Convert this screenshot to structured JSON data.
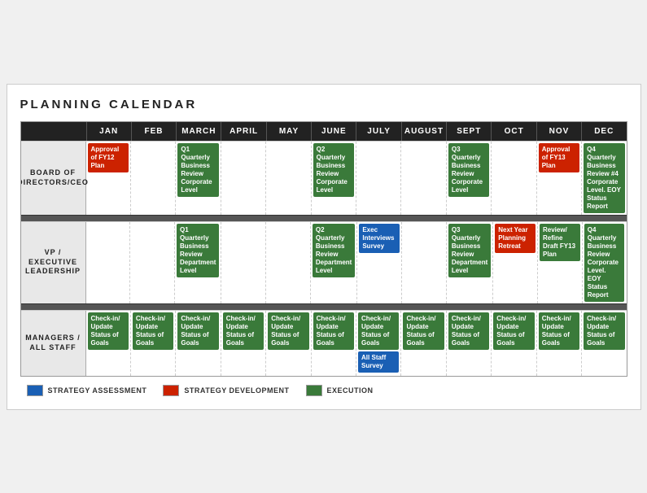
{
  "title": "PLANNING CALENDAR",
  "months": [
    "JAN",
    "FEB",
    "MARCH",
    "APRIL",
    "MAY",
    "JUNE",
    "JULY",
    "AUGUST",
    "SEPT",
    "OCT",
    "NOV",
    "DEC"
  ],
  "sections": [
    {
      "label": "BOARD OF\nDIRECTORS/CEO",
      "cells": [
        {
          "month": 0,
          "events": [
            {
              "color": "red",
              "text": "Approval of FY12 Plan"
            }
          ]
        },
        {
          "month": 1,
          "events": []
        },
        {
          "month": 2,
          "events": [
            {
              "color": "green",
              "text": "Q1 Quarterly Business Review Corporate Level"
            }
          ]
        },
        {
          "month": 3,
          "events": []
        },
        {
          "month": 4,
          "events": []
        },
        {
          "month": 5,
          "events": [
            {
              "color": "green",
              "text": "Q2 Quarterly Business Review Corporate Level"
            }
          ]
        },
        {
          "month": 6,
          "events": []
        },
        {
          "month": 7,
          "events": []
        },
        {
          "month": 8,
          "events": [
            {
              "color": "green",
              "text": "Q3 Quarterly Business Review Corporate Level"
            }
          ]
        },
        {
          "month": 9,
          "events": []
        },
        {
          "month": 10,
          "events": [
            {
              "color": "red",
              "text": "Approval of FY13 Plan"
            }
          ]
        },
        {
          "month": 11,
          "events": [
            {
              "color": "green",
              "text": "Q4 Quarterly Business Review #4 Corporate Level. EOY Status Report"
            }
          ]
        }
      ]
    },
    {
      "label": "VP / EXECUTIVE\nLEADERSHIP",
      "cells": [
        {
          "month": 0,
          "events": []
        },
        {
          "month": 1,
          "events": []
        },
        {
          "month": 2,
          "events": [
            {
              "color": "green",
              "text": "Q1 Quarterly Business Review Department Level"
            }
          ]
        },
        {
          "month": 3,
          "events": []
        },
        {
          "month": 4,
          "events": []
        },
        {
          "month": 5,
          "events": [
            {
              "color": "green",
              "text": "Q2 Quarterly Business Review Department Level"
            }
          ]
        },
        {
          "month": 6,
          "events": [
            {
              "color": "blue",
              "text": "Exec Interviews Survey"
            }
          ]
        },
        {
          "month": 7,
          "events": []
        },
        {
          "month": 8,
          "events": [
            {
              "color": "green",
              "text": "Q3 Quarterly Business Review Department Level"
            }
          ]
        },
        {
          "month": 9,
          "events": [
            {
              "color": "red",
              "text": "Next Year Planning Retreat"
            }
          ]
        },
        {
          "month": 10,
          "events": [
            {
              "color": "green",
              "text": "Review/ Refine Draft FY13 Plan"
            }
          ]
        },
        {
          "month": 11,
          "events": [
            {
              "color": "green",
              "text": "Q4 Quarterly Business Review Corporate Level. EOY Status Report"
            }
          ]
        }
      ]
    },
    {
      "label": "MANAGERS /\nALL STAFF",
      "cells": [
        {
          "month": 0,
          "events": [
            {
              "color": "green",
              "text": "Check-in/ Update Status of Goals"
            }
          ]
        },
        {
          "month": 1,
          "events": [
            {
              "color": "green",
              "text": "Check-in/ Update Status of Goals"
            }
          ]
        },
        {
          "month": 2,
          "events": [
            {
              "color": "green",
              "text": "Check-in/ Update Status of Goals"
            }
          ]
        },
        {
          "month": 3,
          "events": [
            {
              "color": "green",
              "text": "Check-in/ Update Status of Goals"
            }
          ]
        },
        {
          "month": 4,
          "events": [
            {
              "color": "green",
              "text": "Check-in/ Update Status of Goals"
            }
          ]
        },
        {
          "month": 5,
          "events": [
            {
              "color": "green",
              "text": "Check-in/ Update Status of Goals"
            }
          ]
        },
        {
          "month": 6,
          "events": [
            {
              "color": "green",
              "text": "Check-in/ Update Status of Goals"
            },
            {
              "color": "blue",
              "text": "All Staff Survey"
            }
          ]
        },
        {
          "month": 7,
          "events": [
            {
              "color": "green",
              "text": "Check-in/ Update Status of Goals"
            }
          ]
        },
        {
          "month": 8,
          "events": [
            {
              "color": "green",
              "text": "Check-in/ Update Status of Goals"
            }
          ]
        },
        {
          "month": 9,
          "events": [
            {
              "color": "green",
              "text": "Check-in/ Update Status of Goals"
            }
          ]
        },
        {
          "month": 10,
          "events": [
            {
              "color": "green",
              "text": "Check-in/ Update Status of Goals"
            }
          ]
        },
        {
          "month": 11,
          "events": [
            {
              "color": "green",
              "text": "Check-in/ Update Status of Goals"
            }
          ]
        }
      ]
    }
  ],
  "legend": [
    {
      "color": "blue",
      "label": "STRATEGY ASSESSMENT"
    },
    {
      "color": "red",
      "label": "STRATEGY DEVELOPMENT"
    },
    {
      "color": "green",
      "label": "EXECUTION"
    }
  ]
}
